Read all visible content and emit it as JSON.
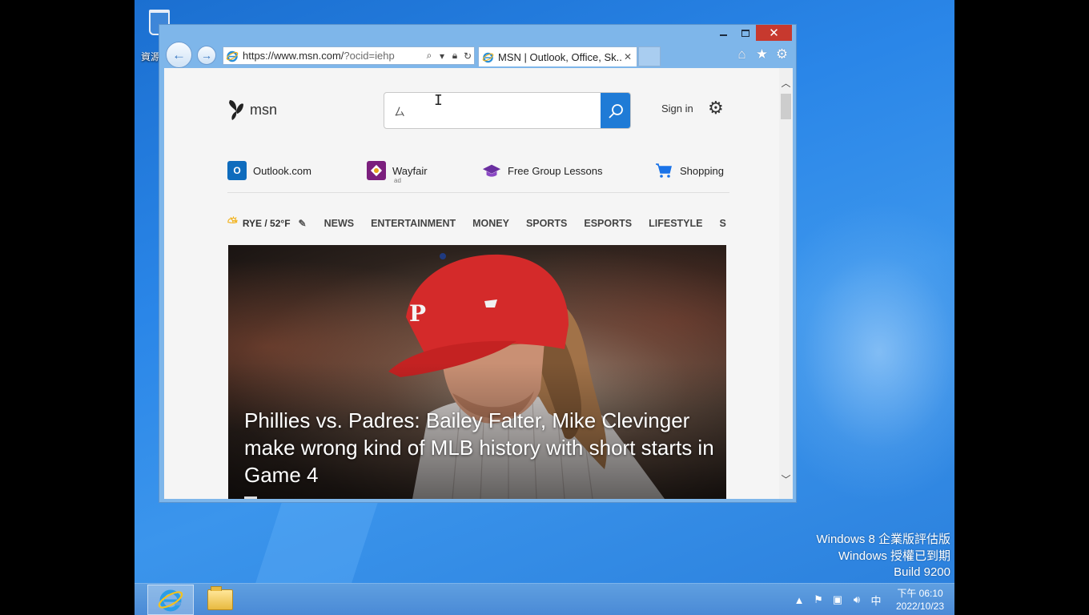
{
  "desktop": {
    "recycle_bin_label": "資源",
    "watermark": {
      "line1": "Windows 8 企業版評估版",
      "line2": "Windows 授權已到期",
      "line3": "Build 9200"
    }
  },
  "browser": {
    "address": {
      "url_host": "https://www.msn.com/",
      "url_rest": "?ocid=iehp"
    },
    "tab": {
      "title": "MSN | Outlook, Office, Sk..."
    },
    "window_controls": {
      "close": "✕"
    }
  },
  "msn": {
    "logo_text": "msn",
    "search": {
      "value": "",
      "glyph": "ㄙ"
    },
    "sign_in": "Sign in",
    "quick_links": [
      {
        "label": "Outlook.com",
        "icon": "outlook-icon"
      },
      {
        "label": "Wayfair",
        "sub": "ad",
        "icon": "wayfair-icon"
      },
      {
        "label": "Free Group Lessons",
        "icon": "graduation-cap-icon"
      },
      {
        "label": "Shopping",
        "icon": "cart-icon"
      }
    ],
    "weather": "RYE / 52°F",
    "nav": [
      "NEWS",
      "ENTERTAINMENT",
      "MONEY",
      "SPORTS",
      "ESPORTS",
      "LIFESTYLE",
      "S"
    ],
    "hero": {
      "title": "Phillies vs. Padres: Bailey Falter, Mike Clevinger make wrong kind of MLB history with short starts in Game 4"
    }
  },
  "taskbar": {
    "ime": "中",
    "time": "下午 06:10",
    "date": "2022/10/23"
  },
  "colors": {
    "search_button": "#1f7bd6",
    "close_button": "#c7392e",
    "desktop_blue": "#2a86e8"
  }
}
